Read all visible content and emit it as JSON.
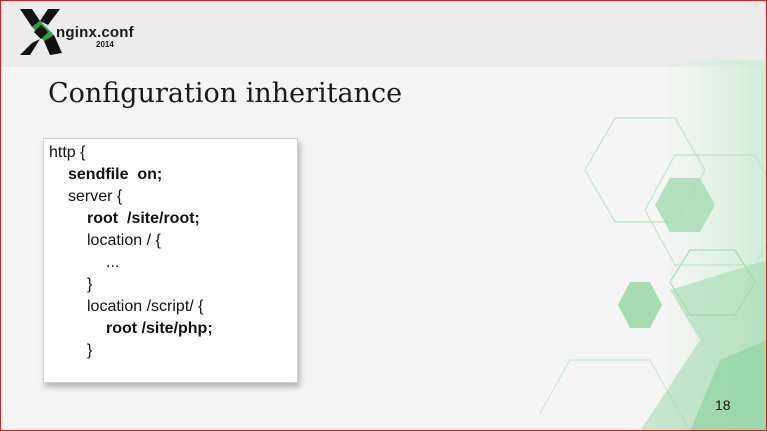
{
  "logo": {
    "name": "nginx.conf",
    "year": "2014"
  },
  "slide": {
    "title": "Configuration inheritance",
    "code_lines": [
      {
        "text": "http {",
        "indent": 0,
        "bold": false
      },
      {
        "text": "sendfile  on;",
        "indent": 1,
        "bold": true
      },
      {
        "text": "server {",
        "indent": 1,
        "bold": false
      },
      {
        "text": "root  /site/root;",
        "indent": 2,
        "bold": true
      },
      {
        "text": "location / {",
        "indent": 2,
        "bold": false
      },
      {
        "text": "...",
        "indent": 3,
        "bold": false
      },
      {
        "text": "}",
        "indent": 2,
        "bold": false
      },
      {
        "text": "location /script/ {",
        "indent": 2,
        "bold": false
      },
      {
        "text": "root /site/php;",
        "indent": 3,
        "bold": true
      },
      {
        "text": "}",
        "indent": 2,
        "bold": false
      }
    ],
    "page_number": "18"
  },
  "colors": {
    "accent_green": "#28a745",
    "light_green": "#b9e6c3",
    "header_gray": "#ececec"
  }
}
